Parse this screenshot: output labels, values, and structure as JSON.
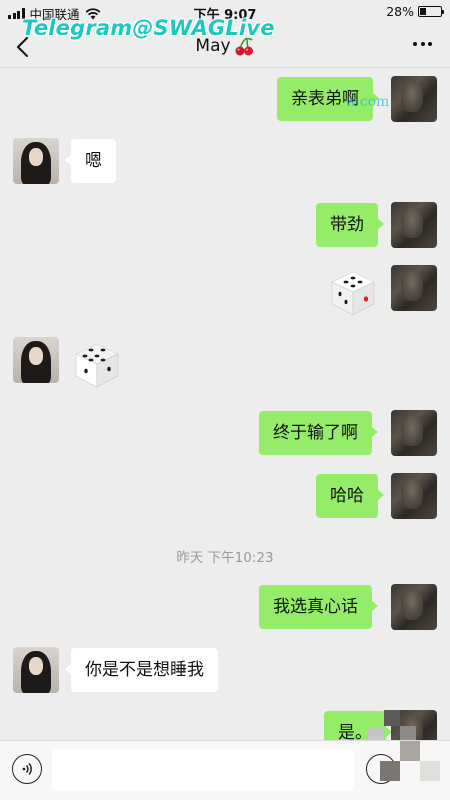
{
  "status_bar": {
    "carrier": "中国联通",
    "time": "下午 9:07",
    "battery": "28%",
    "battery_level": 0.28
  },
  "watermark": {
    "top": "Telegram@SWAGLive",
    "middle": "w.com"
  },
  "nav": {
    "title": "May",
    "title_icon": "cherry-icon"
  },
  "messages": [
    {
      "sender": "me",
      "type": "text",
      "text": "亲表弟啊"
    },
    {
      "sender": "her",
      "type": "text",
      "text": "嗯"
    },
    {
      "sender": "me",
      "type": "text",
      "text": "带劲"
    },
    {
      "sender": "me",
      "type": "dice",
      "value": 4
    },
    {
      "sender": "her",
      "type": "dice",
      "value": 6
    },
    {
      "sender": "me",
      "type": "text",
      "text": "终于输了啊"
    },
    {
      "sender": "me",
      "type": "text",
      "text": "哈哈"
    },
    {
      "type": "timestamp",
      "text": "昨天 下午10:23"
    },
    {
      "sender": "me",
      "type": "text",
      "text": "我选真心话"
    },
    {
      "sender": "her",
      "type": "text",
      "text": "你是不是想睡我"
    },
    {
      "sender": "me",
      "type": "text",
      "text": "是。"
    }
  ],
  "input": {
    "value": "",
    "placeholder": ""
  },
  "colors": {
    "my_bubble": "#95ec69",
    "her_bubble": "#ffffff",
    "background": "#ededed",
    "watermark": "#1ec8c0"
  }
}
